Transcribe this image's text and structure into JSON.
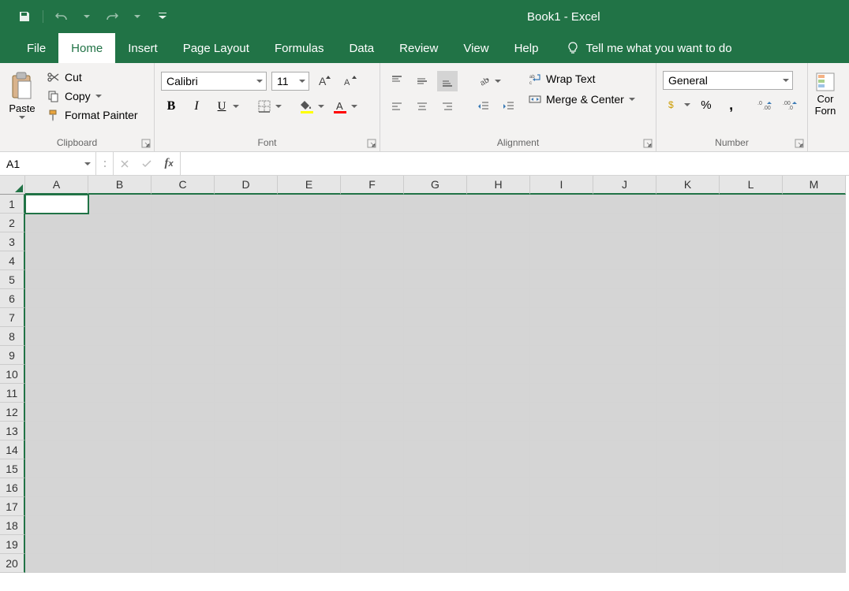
{
  "title": "Book1  -  Excel",
  "tabs": [
    "File",
    "Home",
    "Insert",
    "Page Layout",
    "Formulas",
    "Data",
    "Review",
    "View",
    "Help"
  ],
  "active_tab": "Home",
  "tell_me": "Tell me what you want to do",
  "clipboard": {
    "paste": "Paste",
    "cut": "Cut",
    "copy": "Copy",
    "format_painter": "Format Painter",
    "label": "Clipboard"
  },
  "font": {
    "name": "Calibri",
    "size": "11",
    "label": "Font"
  },
  "alignment": {
    "wrap": "Wrap Text",
    "merge": "Merge & Center",
    "label": "Alignment"
  },
  "number": {
    "format": "General",
    "label": "Number"
  },
  "styles": {
    "cond1": "Cor",
    "cond2": "Forn"
  },
  "name_box": "A1",
  "columns": [
    "A",
    "B",
    "C",
    "D",
    "E",
    "F",
    "G",
    "H",
    "I",
    "J",
    "K",
    "L",
    "M"
  ],
  "rows": [
    "1",
    "2",
    "3",
    "4",
    "5",
    "6",
    "7",
    "8",
    "9",
    "10",
    "11",
    "12",
    "13",
    "14",
    "15",
    "16",
    "17",
    "18",
    "19",
    "20"
  ],
  "active_cell": {
    "row": 0,
    "col": 0
  }
}
